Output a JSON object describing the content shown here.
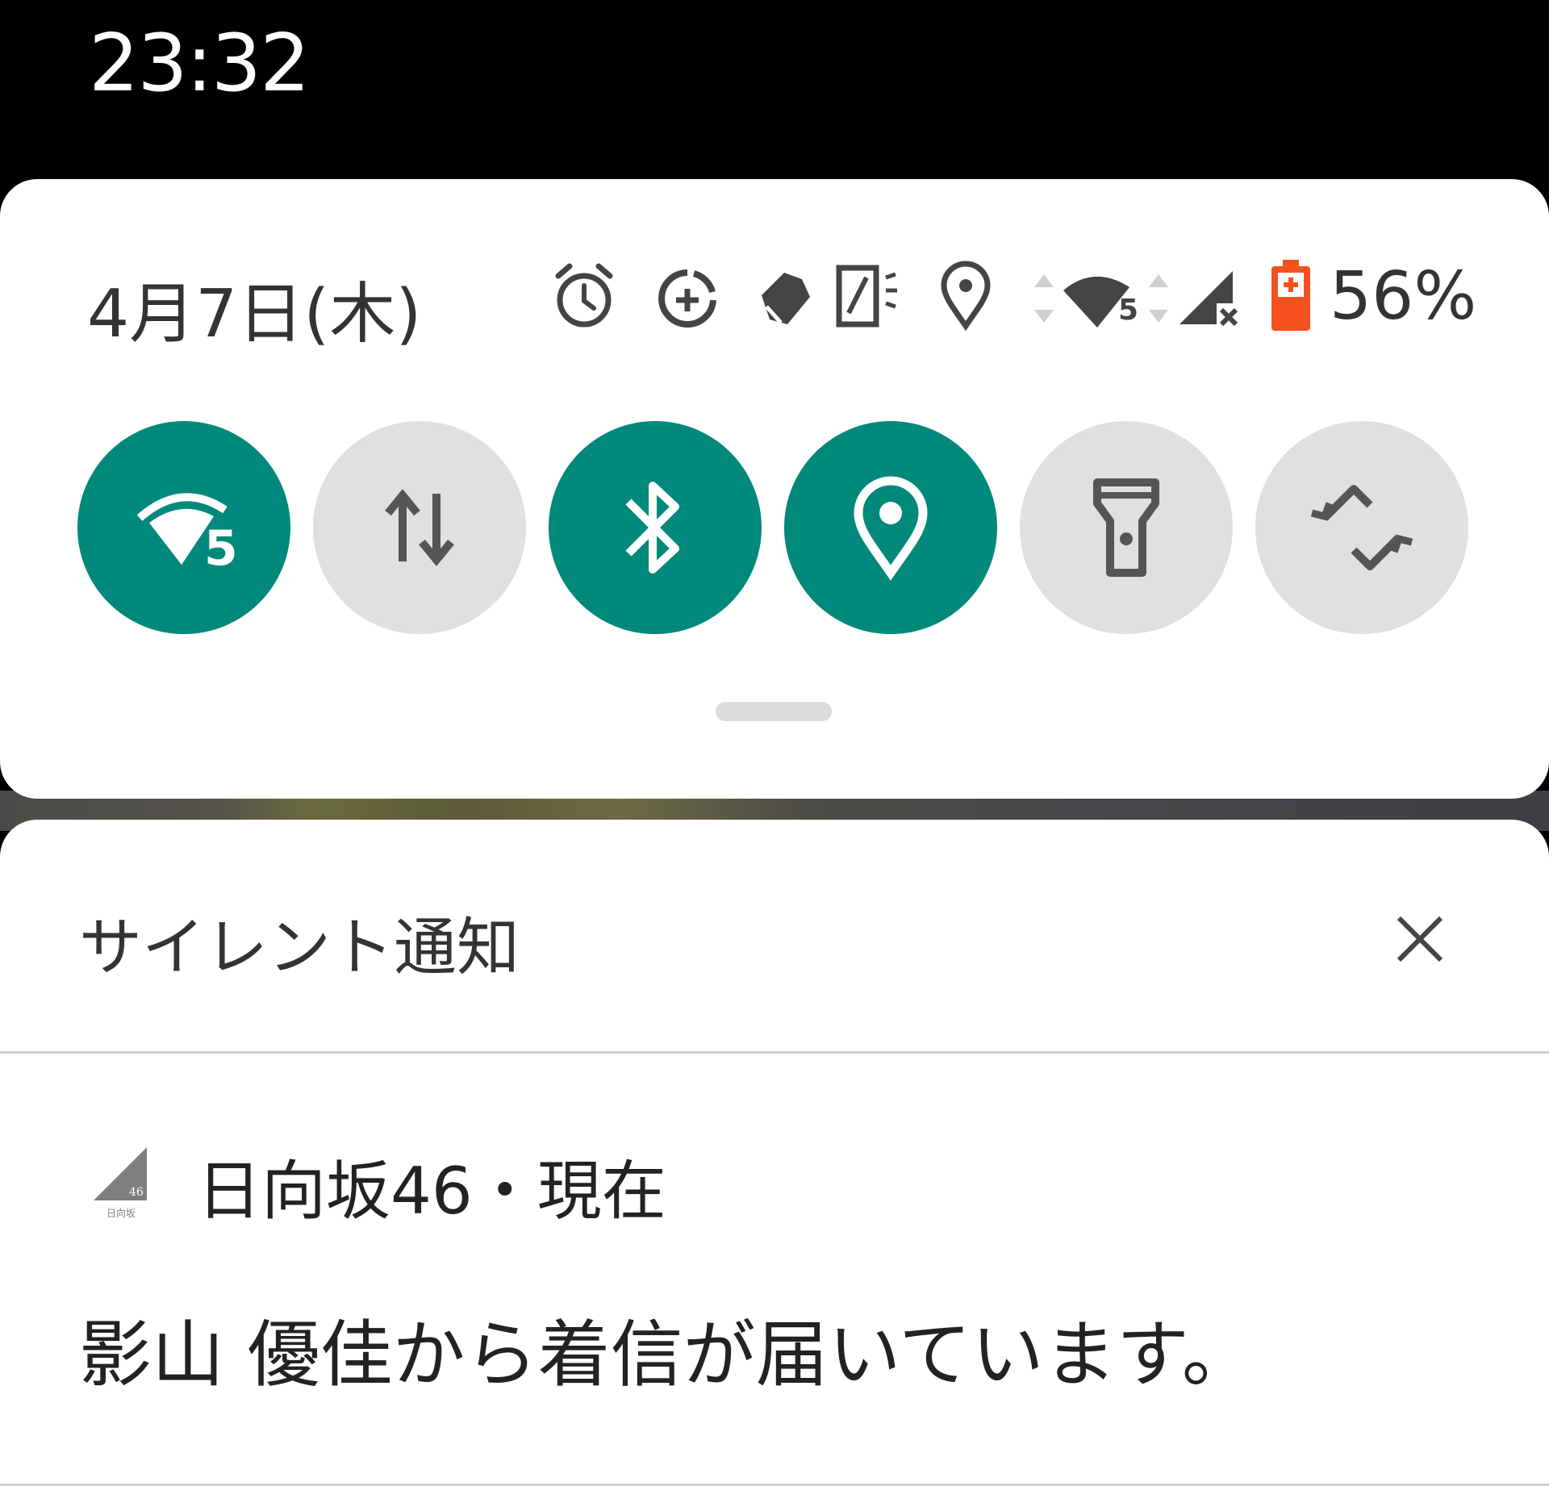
{
  "status_bar": {
    "time": "23:32"
  },
  "quick_settings": {
    "date": "4月7日(木)",
    "battery_percent": "56%",
    "status_icons": [
      "alarm-icon",
      "data-saver-icon",
      "do-not-disturb-icon",
      "nfc-icon",
      "location-icon",
      "wifi-5-icon",
      "mobile-signal-off-icon",
      "battery-charging-icon"
    ],
    "tiles": [
      {
        "name": "wifi",
        "icon": "wifi-5-icon",
        "state": "on"
      },
      {
        "name": "mobile-data",
        "icon": "data-arrows-icon",
        "state": "off"
      },
      {
        "name": "bluetooth",
        "icon": "bluetooth-icon",
        "state": "on"
      },
      {
        "name": "location",
        "icon": "location-icon",
        "state": "on"
      },
      {
        "name": "flashlight",
        "icon": "flashlight-icon",
        "state": "off"
      },
      {
        "name": "auto-rotate",
        "icon": "rotate-icon",
        "state": "off"
      }
    ],
    "colors": {
      "tile_on": "#00897b",
      "tile_off": "#e0e0e0",
      "battery": "#f4511e"
    }
  },
  "notifications": {
    "section_title": "サイレント通知",
    "items": [
      {
        "app_line": "日向坂46・現在",
        "app_icon_text": "46",
        "app_icon_caption": "日向坂",
        "message": "影山 優佳から着信が届いています。"
      }
    ]
  }
}
